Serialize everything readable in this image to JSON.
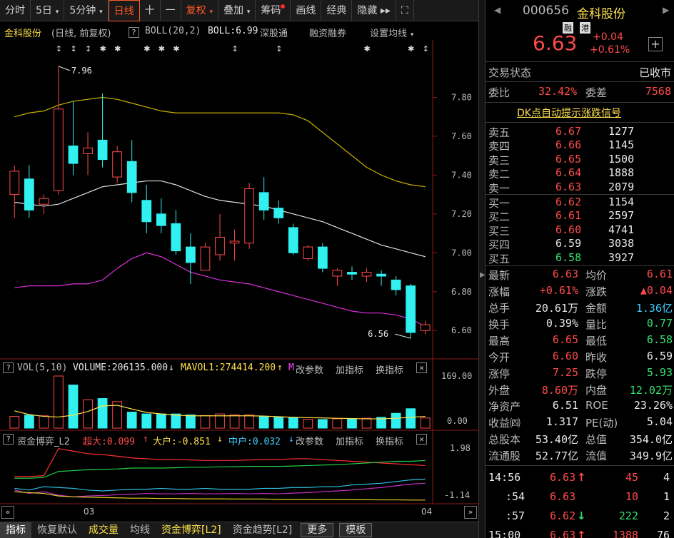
{
  "toolbar": {
    "items": [
      {
        "label": "分时",
        "dropdown": false
      },
      {
        "label": "5日",
        "dropdown": true
      },
      {
        "label": "5分钟",
        "dropdown": true
      },
      {
        "label": "日线",
        "dropdown": false,
        "active": true
      },
      {
        "label": "十",
        "dropdown": false
      },
      {
        "label": "一",
        "dropdown": false
      },
      {
        "label": "复权",
        "dropdown": true,
        "red": true
      },
      {
        "label": "叠加",
        "dropdown": true
      },
      {
        "label": "筹码",
        "dropdown": false,
        "dot": true
      },
      {
        "label": "画线",
        "dropdown": false
      },
      {
        "label": "经典",
        "dropdown": false
      },
      {
        "label": "隐藏 ▸▸",
        "dropdown": false
      },
      {
        "label": "⛶",
        "dropdown": false
      }
    ]
  },
  "infobar": {
    "name": "金科股份",
    "mode": "(日线, 前复权)",
    "help": "?",
    "indicator": "BOLL(20,2)",
    "boll": "BOLL:6.99",
    "link1": "深股通",
    "link2": "融资融券",
    "settings": "设置均线"
  },
  "main_chart": {
    "y_labels": [
      "7.80",
      "7.60",
      "7.40",
      "7.20",
      "7.00",
      "6.80",
      "6.60"
    ],
    "high_label": "7.96",
    "low_label": "6.56"
  },
  "volume_panel": {
    "title": "VOL(5,10)",
    "volume": "VOLUME:206135.000",
    "mavol": "MAVOL1:274414.200",
    "arrow1": "↓",
    "arrow2": "↑",
    "m_label": "M",
    "change_param": "改参数",
    "add_ind": "加指标",
    "switch_ind": "换指标",
    "y_top": "169.00",
    "y_bottom": "0.00"
  },
  "capital_panel": {
    "title": "资金博弈_L2",
    "super": "超大:0.099",
    "big": "大户:-0.851",
    "mid": "中户:0.032",
    "arrow_up": "↑",
    "arrow_down": "↓",
    "change_param": "改参数",
    "add_ind": "加指标",
    "switch_ind": "换指标",
    "y_top": "1.98",
    "y_bottom": "-1.14"
  },
  "x_axis": {
    "label1": "03",
    "label2": "04"
  },
  "bottom_tabs": [
    {
      "label": "指标",
      "style": "sel"
    },
    {
      "label": "恢复默认",
      "style": ""
    },
    {
      "label": "成交量",
      "style": "yl"
    },
    {
      "label": "均线",
      "style": ""
    },
    {
      "label": "资金博弈[L2]",
      "style": "yl"
    },
    {
      "label": "资金趋势[L2]",
      "style": ""
    },
    {
      "label": "更多",
      "style": "box"
    },
    {
      "label": "模板",
      "style": "box"
    }
  ],
  "right": {
    "code": "000656",
    "name": "金科股份",
    "tag1": "融",
    "tag2": "港",
    "price": "6.63",
    "chg": "+0.04",
    "pct": "+0.61%",
    "trade_status_label": "交易状态",
    "trade_status": "已收市",
    "wb_label": "委比",
    "wb": "32.42%",
    "wc_label": "委差",
    "wc": "7568",
    "dk_link": "DK点自动提示涨跌信号",
    "asks": [
      {
        "label": "卖五",
        "price": "6.67",
        "vol": "1277"
      },
      {
        "label": "卖四",
        "price": "6.66",
        "vol": "1145"
      },
      {
        "label": "卖三",
        "price": "6.65",
        "vol": "1500"
      },
      {
        "label": "卖二",
        "price": "6.64",
        "vol": "1888"
      },
      {
        "label": "卖一",
        "price": "6.63",
        "vol": "2079"
      }
    ],
    "bids": [
      {
        "label": "买一",
        "price": "6.62",
        "vol": "1154"
      },
      {
        "label": "买二",
        "price": "6.61",
        "vol": "2597"
      },
      {
        "label": "买三",
        "price": "6.60",
        "vol": "4741"
      },
      {
        "label": "买四",
        "price": "6.59",
        "vol": "3038"
      },
      {
        "label": "买五",
        "price": "6.58",
        "vol": "3927"
      }
    ],
    "stats": [
      {
        "l1": "最新",
        "v1": "6.63",
        "c1": "#ff4a4a",
        "l2": "均价",
        "v2": "6.61",
        "c2": "#ff4a4a"
      },
      {
        "l1": "涨幅",
        "v1": "+0.61%",
        "c1": "#ff4a4a",
        "l2": "涨跌",
        "v2": "▲0.04",
        "c2": "#ff4a4a"
      },
      {
        "l1": "总手",
        "v1": "20.61万",
        "c1": "#e8e8e8",
        "l2": "金额",
        "v2": "1.36亿",
        "c2": "#3fd0ff"
      },
      {
        "l1": "换手",
        "v1": "0.39%",
        "c1": "#e8e8e8",
        "l2": "量比",
        "v2": "0.77",
        "c2": "#33e070"
      },
      {
        "l1": "最高",
        "v1": "6.65",
        "c1": "#ff4a4a",
        "l2": "最低",
        "v2": "6.58",
        "c2": "#33e070"
      },
      {
        "l1": "今开",
        "v1": "6.60",
        "c1": "#ff4a4a",
        "l2": "昨收",
        "v2": "6.59",
        "c2": "#e8e8e8"
      },
      {
        "l1": "涨停",
        "v1": "7.25",
        "c1": "#ff4a4a",
        "l2": "跌停",
        "v2": "5.93",
        "c2": "#33e070"
      },
      {
        "l1": "外盘",
        "v1": "8.60万",
        "c1": "#ff4a4a",
        "l2": "内盘",
        "v2": "12.02万",
        "c2": "#33e070"
      },
      {
        "l1": "净资产",
        "v1": "6.51",
        "c1": "#e8e8e8",
        "l2": "ROE",
        "v2": "23.26%",
        "c2": "#e8e8e8"
      },
      {
        "l1": "收益㈣",
        "v1": "1.317",
        "c1": "#e8e8e8",
        "l2": "PE(动)",
        "v2": "5.04",
        "c2": "#e8e8e8"
      },
      {
        "l1": "总股本",
        "v1": "53.40亿",
        "c1": "#e8e8e8",
        "l2": "总值",
        "v2": "354.0亿",
        "c2": "#e8e8e8"
      },
      {
        "l1": "流通股",
        "v1": "52.77亿",
        "c1": "#e8e8e8",
        "l2": "流值",
        "v2": "349.9亿",
        "c2": "#e8e8e8"
      }
    ],
    "ticks": [
      {
        "time": "14:56",
        "price": "6.63",
        "arrow": "↑",
        "arrow_color": "#ff4a4a",
        "vol": "45",
        "vol_color": "#ff4a4a",
        "n": "4"
      },
      {
        "time": ":54",
        "price": "6.63",
        "arrow": "",
        "arrow_color": "#ff4a4a",
        "vol": "10",
        "vol_color": "#ff4a4a",
        "n": "1"
      },
      {
        "time": ":57",
        "price": "6.62",
        "arrow": "↓",
        "arrow_color": "#33e070",
        "vol": "222",
        "vol_color": "#33e070",
        "n": "2"
      },
      {
        "time": "15:00",
        "price": "6.63",
        "arrow": "↑",
        "arrow_color": "#ff4a4a",
        "vol": "1388",
        "vol_color": "#ff4a4a",
        "n": "76"
      }
    ]
  },
  "chart_data": {
    "type": "candlestick",
    "candles": [
      {
        "o": 7.3,
        "h": 7.45,
        "l": 7.18,
        "c": 7.42
      },
      {
        "o": 7.38,
        "h": 7.45,
        "l": 7.18,
        "c": 7.22
      },
      {
        "o": 7.25,
        "h": 7.3,
        "l": 7.2,
        "c": 7.28
      },
      {
        "o": 7.32,
        "h": 7.96,
        "l": 7.3,
        "c": 7.74
      },
      {
        "o": 7.55,
        "h": 7.78,
        "l": 7.4,
        "c": 7.46
      },
      {
        "o": 7.51,
        "h": 7.62,
        "l": 7.4,
        "c": 7.54
      },
      {
        "o": 7.58,
        "h": 7.82,
        "l": 7.44,
        "c": 7.48
      },
      {
        "o": 7.39,
        "h": 7.55,
        "l": 7.36,
        "c": 7.52
      },
      {
        "o": 7.47,
        "h": 7.58,
        "l": 7.26,
        "c": 7.31
      },
      {
        "o": 7.27,
        "h": 7.35,
        "l": 7.1,
        "c": 7.16
      },
      {
        "o": 7.2,
        "h": 7.28,
        "l": 7.1,
        "c": 7.14
      },
      {
        "o": 7.15,
        "h": 7.22,
        "l": 6.99,
        "c": 7.01
      },
      {
        "o": 7.03,
        "h": 7.1,
        "l": 6.84,
        "c": 6.95
      },
      {
        "o": 6.91,
        "h": 7.05,
        "l": 6.91,
        "c": 7.03
      },
      {
        "o": 6.99,
        "h": 7.2,
        "l": 6.96,
        "c": 7.08
      },
      {
        "o": 7.05,
        "h": 7.12,
        "l": 6.96,
        "c": 7.06
      },
      {
        "o": 7.05,
        "h": 7.36,
        "l": 7.02,
        "c": 7.33
      },
      {
        "o": 7.31,
        "h": 7.39,
        "l": 7.17,
        "c": 7.22
      },
      {
        "o": 7.23,
        "h": 7.27,
        "l": 7.15,
        "c": 7.18
      },
      {
        "o": 7.13,
        "h": 7.15,
        "l": 6.99,
        "c": 7.0
      },
      {
        "o": 6.97,
        "h": 7.04,
        "l": 6.96,
        "c": 7.03
      },
      {
        "o": 7.03,
        "h": 7.05,
        "l": 6.9,
        "c": 6.92
      },
      {
        "o": 6.88,
        "h": 6.92,
        "l": 6.83,
        "c": 6.91
      },
      {
        "o": 6.9,
        "h": 6.93,
        "l": 6.86,
        "c": 6.89
      },
      {
        "o": 6.88,
        "h": 6.92,
        "l": 6.85,
        "c": 6.9
      },
      {
        "o": 6.89,
        "h": 6.91,
        "l": 6.83,
        "c": 6.88
      },
      {
        "o": 6.86,
        "h": 6.88,
        "l": 6.78,
        "c": 6.81
      },
      {
        "o": 6.83,
        "h": 6.84,
        "l": 6.56,
        "c": 6.59
      },
      {
        "o": 6.6,
        "h": 6.65,
        "l": 6.58,
        "c": 6.63
      }
    ],
    "boll_upper": [
      7.7,
      7.72,
      7.73,
      7.76,
      7.78,
      7.79,
      7.8,
      7.79,
      7.77,
      7.75,
      7.73,
      7.72,
      7.72,
      7.72,
      7.72,
      7.72,
      7.72,
      7.72,
      7.72,
      7.71,
      7.68,
      7.62,
      7.56,
      7.5,
      7.44,
      7.4,
      7.37,
      7.35,
      7.34
    ],
    "boll_mid": [
      7.26,
      7.25,
      7.24,
      7.25,
      7.28,
      7.31,
      7.34,
      7.35,
      7.36,
      7.37,
      7.37,
      7.35,
      7.32,
      7.29,
      7.27,
      7.26,
      7.25,
      7.24,
      7.22,
      7.2,
      7.18,
      7.16,
      7.13,
      7.1,
      7.07,
      7.04,
      7.02,
      7.0,
      6.98
    ],
    "boll_lower": [
      6.82,
      6.83,
      6.83,
      6.83,
      6.84,
      6.84,
      6.86,
      6.92,
      6.97,
      7.0,
      6.98,
      6.94,
      6.9,
      6.88,
      6.86,
      6.85,
      6.84,
      6.82,
      6.8,
      6.78,
      6.76,
      6.74,
      6.72,
      6.7,
      6.69,
      6.69,
      6.68,
      6.66,
      6.62
    ],
    "ylim": [
      6.52,
      8.0
    ],
    "volume": [
      38,
      42,
      40,
      169,
      140,
      92,
      96,
      86,
      52,
      46,
      46,
      46,
      43,
      41,
      46,
      43,
      43,
      38,
      36,
      35,
      29,
      28,
      30,
      31,
      32,
      35,
      48,
      63,
      33
    ],
    "vol_ylim": [
      0,
      169
    ],
    "ma5": [
      56,
      44,
      38,
      36,
      42,
      54,
      72,
      74,
      62,
      51,
      46,
      42,
      40,
      40,
      40,
      40,
      40,
      39,
      37,
      35,
      34,
      33,
      32,
      31,
      30,
      30,
      32,
      35,
      38
    ],
    "cap_super": [
      0.3,
      0.3,
      0.35,
      1.95,
      1.8,
      1.65,
      1.6,
      1.5,
      1.4,
      1.35,
      1.3,
      1.3,
      1.28,
      1.25,
      1.25,
      1.25,
      1.28,
      1.3,
      1.3,
      1.35,
      1.35,
      1.3,
      1.25,
      1.2,
      1.15,
      1.1,
      1.05,
      1.0,
      0.95
    ],
    "cap_mid": [
      0.2,
      0.2,
      0.25,
      0.6,
      0.65,
      0.7,
      0.72,
      0.75,
      0.8,
      0.8,
      0.8,
      0.82,
      0.85,
      0.85,
      0.87,
      0.88,
      0.9,
      0.9,
      0.9,
      0.92,
      0.95,
      0.98,
      1.0,
      1.05,
      1.1,
      1.15,
      1.2,
      1.2,
      1.25
    ],
    "cap_cyan": [
      -0.4,
      -0.5,
      -0.3,
      -0.35,
      -0.4,
      -0.5,
      -0.55,
      -0.5,
      -0.45,
      -0.45,
      -0.4,
      -0.45,
      -0.45,
      -0.4,
      -0.45,
      -0.45,
      -0.45,
      -0.4,
      -0.4,
      -0.35,
      -0.35,
      -0.3,
      -0.3,
      -0.2,
      -0.15,
      -0.1,
      0.0,
      0.1,
      0.15
    ],
    "cap_yellow": [
      -0.6,
      -0.65,
      -0.7,
      -0.85,
      -0.9,
      -0.92,
      -0.94,
      -0.96,
      -0.98,
      -0.98,
      -1.0,
      -1.0,
      -1.02,
      -1.02,
      -1.02,
      -1.03,
      -1.03,
      -1.03,
      -1.05,
      -1.05,
      -1.05,
      -1.06,
      -1.06,
      -1.07,
      -1.07,
      -1.08,
      -1.08,
      -1.09,
      -1.09
    ],
    "cap_magenta": [
      -0.5,
      -0.7,
      -0.6,
      -0.8,
      -0.9,
      -0.85,
      -0.82,
      -0.78,
      -0.75,
      -0.7,
      -0.72,
      -0.72,
      -0.7,
      -0.72,
      -0.72,
      -0.7,
      -0.72,
      -0.7,
      -0.72,
      -0.68,
      -0.65,
      -0.6,
      -0.55,
      -0.5,
      -0.42,
      -0.35,
      -0.25,
      -0.15,
      -0.1
    ],
    "cap_ylim": [
      -1.14,
      1.98
    ],
    "up_color": "#ff4a4a",
    "down_color": "#30f0f0"
  }
}
